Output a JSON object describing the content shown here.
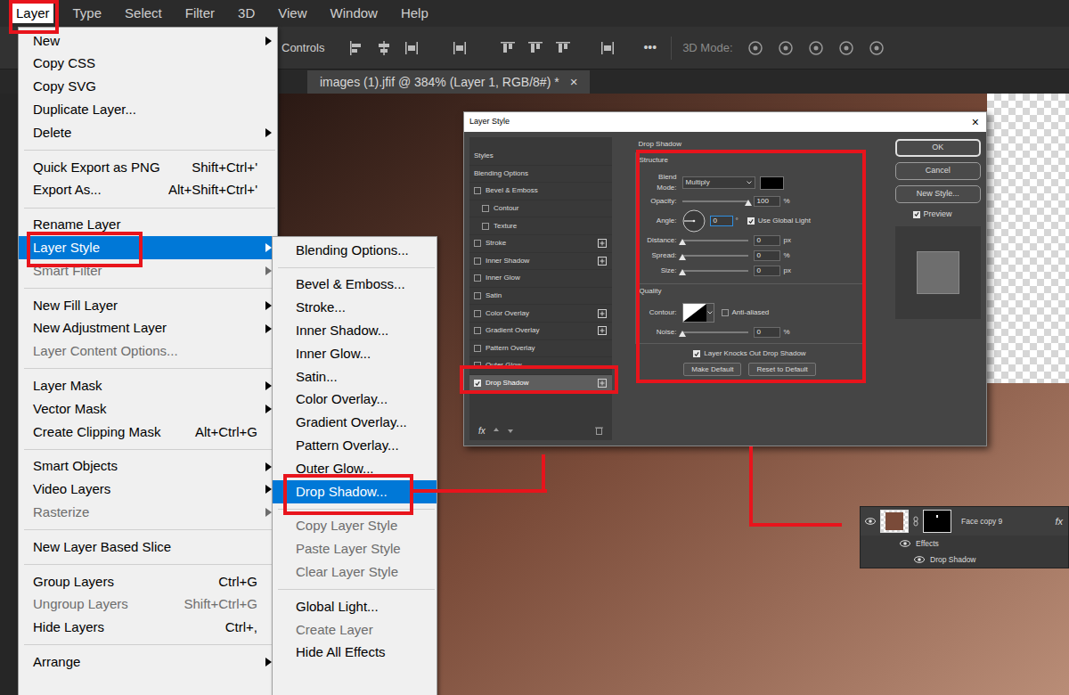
{
  "menubar": {
    "items": [
      {
        "label": "Layer",
        "selected": true
      },
      {
        "label": "Type",
        "selected": false
      },
      {
        "label": "Select",
        "selected": false
      },
      {
        "label": "Filter",
        "selected": false
      },
      {
        "label": "3D",
        "selected": false
      },
      {
        "label": "View",
        "selected": false
      },
      {
        "label": "Window",
        "selected": false
      },
      {
        "label": "Help",
        "selected": false
      }
    ]
  },
  "options_bar": {
    "label": "Controls",
    "more": "•••",
    "mode_label": "3D Mode:"
  },
  "document_tab": {
    "title": "images (1).jfif @ 384% (Layer 1, RGB/8#) *",
    "close": "×"
  },
  "layer_menu": {
    "groups": [
      [
        {
          "label": "New",
          "submenu": true,
          "disabled": false,
          "selected": false
        },
        {
          "label": "Copy CSS",
          "submenu": false,
          "disabled": false,
          "selected": false
        },
        {
          "label": "Copy SVG",
          "submenu": false,
          "disabled": false,
          "selected": false
        },
        {
          "label": "Duplicate Layer...",
          "submenu": false,
          "disabled": false,
          "selected": false
        },
        {
          "label": "Delete",
          "submenu": true,
          "disabled": false,
          "selected": false
        }
      ],
      [
        {
          "label": "Quick Export as PNG",
          "shortcut": "Shift+Ctrl+'",
          "submenu": false,
          "disabled": false,
          "selected": false
        },
        {
          "label": "Export As...",
          "shortcut": "Alt+Shift+Ctrl+'",
          "submenu": false,
          "disabled": false,
          "selected": false
        }
      ],
      [
        {
          "label": "Rename Layer",
          "submenu": false,
          "disabled": false,
          "selected": false
        },
        {
          "label": "Layer Style",
          "submenu": true,
          "disabled": false,
          "selected": true
        },
        {
          "label": "Smart Filter",
          "submenu": true,
          "disabled": true,
          "selected": false
        }
      ],
      [
        {
          "label": "New Fill Layer",
          "submenu": true,
          "disabled": false,
          "selected": false
        },
        {
          "label": "New Adjustment Layer",
          "submenu": true,
          "disabled": false,
          "selected": false
        },
        {
          "label": "Layer Content Options...",
          "submenu": false,
          "disabled": true,
          "selected": false
        }
      ],
      [
        {
          "label": "Layer Mask",
          "submenu": true,
          "disabled": false,
          "selected": false
        },
        {
          "label": "Vector Mask",
          "submenu": true,
          "disabled": false,
          "selected": false
        },
        {
          "label": "Create Clipping Mask",
          "shortcut": "Alt+Ctrl+G",
          "submenu": false,
          "disabled": false,
          "selected": false
        }
      ],
      [
        {
          "label": "Smart Objects",
          "submenu": true,
          "disabled": false,
          "selected": false
        },
        {
          "label": "Video Layers",
          "submenu": true,
          "disabled": false,
          "selected": false
        },
        {
          "label": "Rasterize",
          "submenu": true,
          "disabled": true,
          "selected": false
        }
      ],
      [
        {
          "label": "New Layer Based Slice",
          "submenu": false,
          "disabled": false,
          "selected": false
        }
      ],
      [
        {
          "label": "Group Layers",
          "shortcut": "Ctrl+G",
          "submenu": false,
          "disabled": false,
          "selected": false
        },
        {
          "label": "Ungroup Layers",
          "shortcut": "Shift+Ctrl+G",
          "submenu": false,
          "disabled": true,
          "selected": false
        },
        {
          "label": "Hide Layers",
          "shortcut": "Ctrl+,",
          "submenu": false,
          "disabled": false,
          "selected": false
        }
      ],
      [
        {
          "label": "Arrange",
          "submenu": true,
          "disabled": false,
          "selected": false
        }
      ]
    ]
  },
  "style_submenu": {
    "groups": [
      [
        {
          "label": "Blending Options...",
          "disabled": false,
          "selected": false
        }
      ],
      [
        {
          "label": "Bevel & Emboss...",
          "disabled": false,
          "selected": false
        },
        {
          "label": "Stroke...",
          "disabled": false,
          "selected": false
        },
        {
          "label": "Inner Shadow...",
          "disabled": false,
          "selected": false
        },
        {
          "label": "Inner Glow...",
          "disabled": false,
          "selected": false
        },
        {
          "label": "Satin...",
          "disabled": false,
          "selected": false
        },
        {
          "label": "Color Overlay...",
          "disabled": false,
          "selected": false
        },
        {
          "label": "Gradient Overlay...",
          "disabled": false,
          "selected": false
        },
        {
          "label": "Pattern Overlay...",
          "disabled": false,
          "selected": false
        },
        {
          "label": "Outer Glow...",
          "disabled": false,
          "selected": false
        },
        {
          "label": "Drop Shadow...",
          "disabled": false,
          "selected": true
        }
      ],
      [
        {
          "label": "Copy Layer Style",
          "disabled": true,
          "selected": false
        },
        {
          "label": "Paste Layer Style",
          "disabled": true,
          "selected": false
        },
        {
          "label": "Clear Layer Style",
          "disabled": true,
          "selected": false
        }
      ],
      [
        {
          "label": "Global Light...",
          "disabled": false,
          "selected": false
        },
        {
          "label": "Create Layer",
          "disabled": true,
          "selected": false
        },
        {
          "label": "Hide All Effects",
          "disabled": false,
          "selected": false
        }
      ]
    ]
  },
  "dialog": {
    "title": "Layer Style",
    "close": "×",
    "styles_list": [
      {
        "label": "Styles",
        "kind": "header",
        "checked": false,
        "selected": false,
        "add_button": false
      },
      {
        "label": "Blending Options",
        "kind": "header",
        "checked": false,
        "selected": false,
        "add_button": false
      },
      {
        "label": "Bevel & Emboss",
        "kind": "check",
        "checked": false,
        "selected": false,
        "add_button": false
      },
      {
        "label": "Contour",
        "kind": "subcheck",
        "checked": false,
        "selected": false,
        "add_button": false
      },
      {
        "label": "Texture",
        "kind": "subcheck",
        "checked": false,
        "selected": false,
        "add_button": false
      },
      {
        "label": "Stroke",
        "kind": "check",
        "checked": false,
        "selected": false,
        "add_button": true
      },
      {
        "label": "Inner Shadow",
        "kind": "check",
        "checked": false,
        "selected": false,
        "add_button": true
      },
      {
        "label": "Inner Glow",
        "kind": "check",
        "checked": false,
        "selected": false,
        "add_button": false
      },
      {
        "label": "Satin",
        "kind": "check",
        "checked": false,
        "selected": false,
        "add_button": false
      },
      {
        "label": "Color Overlay",
        "kind": "check",
        "checked": false,
        "selected": false,
        "add_button": true
      },
      {
        "label": "Gradient Overlay",
        "kind": "check",
        "checked": false,
        "selected": false,
        "add_button": true
      },
      {
        "label": "Pattern Overlay",
        "kind": "check",
        "checked": false,
        "selected": false,
        "add_button": false
      },
      {
        "label": "Outer Glow",
        "kind": "check",
        "checked": false,
        "selected": false,
        "add_button": false
      },
      {
        "label": "Drop Shadow",
        "kind": "check",
        "checked": true,
        "selected": true,
        "add_button": true
      }
    ],
    "footer": {
      "fx": "fx"
    },
    "section": "Drop Shadow",
    "structure": {
      "title": "Structure",
      "blend_mode": {
        "label": "Blend Mode:",
        "value": "Multiply",
        "swatch": "#000000"
      },
      "opacity": {
        "label": "Opacity:",
        "value": "100",
        "unit": "%",
        "level": 1
      },
      "angle": {
        "label": "Angle:",
        "value": "0",
        "unit": "°",
        "global_light": {
          "label": "Use Global Light",
          "checked": true
        }
      },
      "sliders": [
        {
          "label": "Distance:",
          "value": "0",
          "unit": "px",
          "level": 0
        },
        {
          "label": "Spread:",
          "value": "0",
          "unit": "%",
          "level": 0
        },
        {
          "label": "Size:",
          "value": "0",
          "unit": "px",
          "level": 0
        }
      ]
    },
    "quality": {
      "title": "Quality",
      "contour": {
        "label": "Contour:",
        "anti_aliased": {
          "label": "Anti-aliased",
          "checked": false
        }
      },
      "noise": {
        "label": "Noise:",
        "value": "0",
        "unit": "%",
        "level": 0
      }
    },
    "knockout": {
      "label": "Layer Knocks Out Drop Shadow",
      "checked": true
    },
    "section_buttons": [
      "Make Default",
      "Reset to Default"
    ],
    "buttons": [
      {
        "label": "OK",
        "default": true
      },
      {
        "label": "Cancel",
        "default": false
      },
      {
        "label": "New Style...",
        "default": false
      }
    ],
    "preview": {
      "label": "Preview",
      "checked": true
    }
  },
  "layers_panel": {
    "layer": {
      "name": "Face copy 9",
      "fx": "fx",
      "visible": true
    },
    "effects": {
      "label": "Effects",
      "visible": true
    },
    "items": [
      {
        "label": "Drop Shadow",
        "visible": true
      }
    ]
  }
}
